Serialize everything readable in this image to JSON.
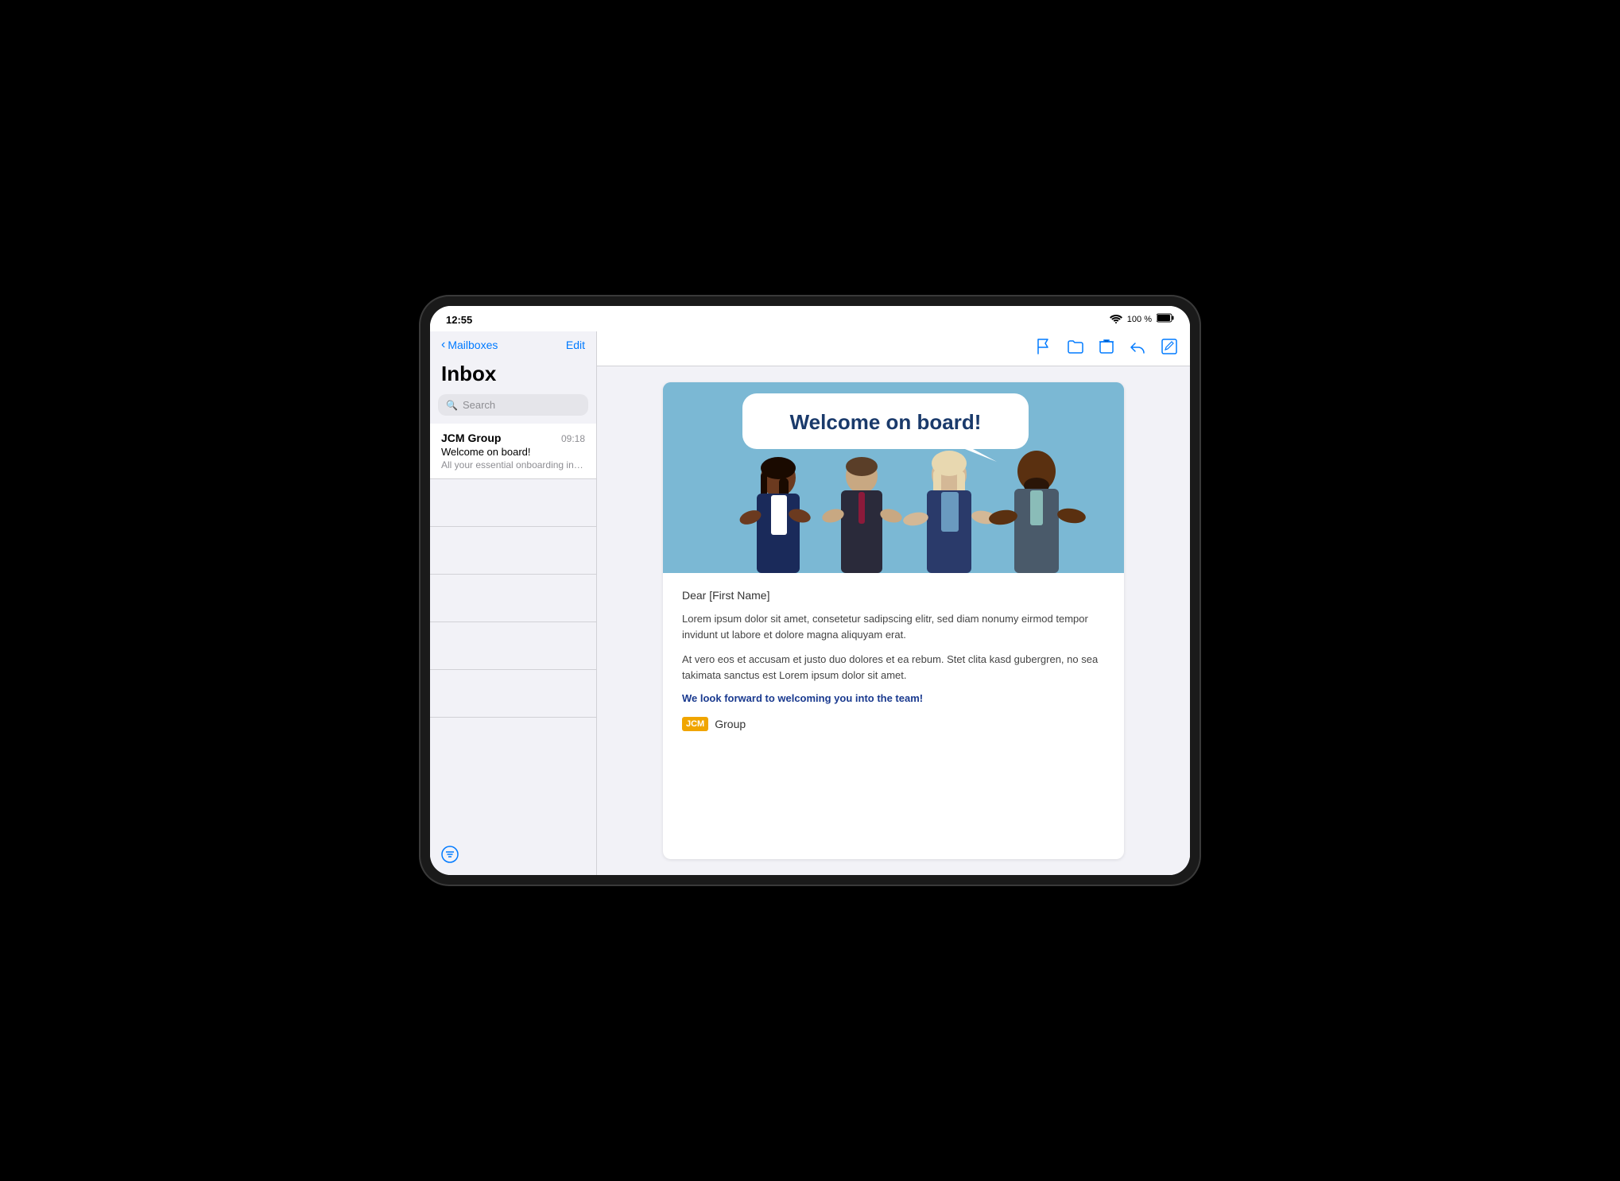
{
  "status_bar": {
    "time": "12:55",
    "wifi": "📶",
    "battery_percent": "100 %",
    "battery_icon": "🔋"
  },
  "sidebar": {
    "back_label": "Mailboxes",
    "edit_label": "Edit",
    "inbox_title": "Inbox",
    "search_placeholder": "Search",
    "emails": [
      {
        "sender": "JCM Group",
        "time": "09:18",
        "subject": "Welcome on board!",
        "preview": "All your essential onboarding information…"
      }
    ]
  },
  "toolbar": {
    "flag_icon": "flag",
    "folder_icon": "folder",
    "trash_icon": "trash",
    "reply_icon": "reply",
    "compose_icon": "compose"
  },
  "email_detail": {
    "banner_text": "Welcome on board!",
    "greeting": "Dear [First Name]",
    "paragraph1": "Lorem ipsum dolor sit amet, consetetur sadipscing elitr, sed diam nonumy eirmod tempor invidunt ut labore et dolore magna aliquyam erat.",
    "paragraph2": "At vero eos et accusam et justo duo dolores et ea rebum. Stet clita kasd gubergren, no sea takimata sanctus est Lorem ipsum dolor sit amet.",
    "cta": "We look forward to welcoming you into the team!",
    "logo_badge": "JCM",
    "logo_text": "Group"
  }
}
